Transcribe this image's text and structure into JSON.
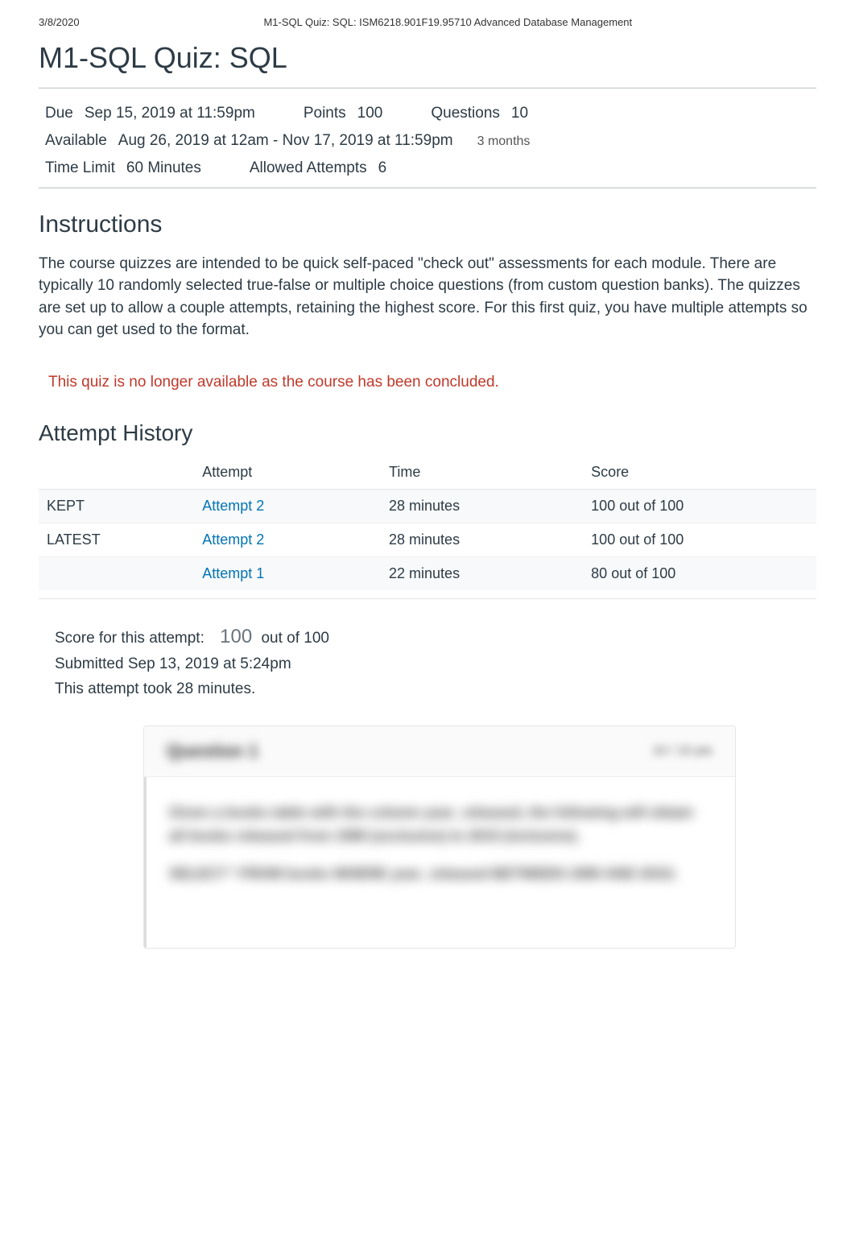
{
  "header": {
    "date": "3/8/2020",
    "course_line": "M1-SQL Quiz: SQL: ISM6218.901F19.95710 Advanced Database Management"
  },
  "title": "M1-SQL Quiz: SQL",
  "meta": {
    "due_label": "Due",
    "due_value": "Sep 15, 2019 at 11:59pm",
    "points_label": "Points",
    "points_value": "100",
    "questions_label": "Questions",
    "questions_value": "10",
    "available_label": "Available",
    "available_value": "Aug 26, 2019 at 12am - Nov 17, 2019 at 11:59pm",
    "available_duration": "3 months",
    "time_limit_label": "Time Limit",
    "time_limit_value": "60 Minutes",
    "allowed_attempts_label": "Allowed Attempts",
    "allowed_attempts_value": "6"
  },
  "instructions": {
    "heading": "Instructions",
    "body": "The course quizzes are intended to be quick self-paced \"check out\" assessments for each module.  There are typically 10 randomly selected true-false or multiple choice questions (from custom question banks).    The quizzes are set up to allow a couple attempts, retaining the highest score.                   For this first quiz, you have multiple attempts so you can get used to the format."
  },
  "alert": "This quiz is no longer available as the course has been concluded.",
  "attempt_history": {
    "heading": "Attempt History",
    "columns": {
      "status": "",
      "attempt": "Attempt",
      "time": "Time",
      "score": "Score"
    },
    "rows": [
      {
        "status": "KEPT",
        "attempt": "Attempt 2",
        "time": "28 minutes",
        "score": "100 out of 100"
      },
      {
        "status": "LATEST",
        "attempt": "Attempt 2",
        "time": "28 minutes",
        "score": "100 out of 100"
      },
      {
        "status": "",
        "attempt": "Attempt 1",
        "time": "22 minutes",
        "score": "80 out of 100"
      }
    ]
  },
  "score_summary": {
    "label": "Score for this attempt:",
    "score": "100",
    "suffix": "out of 100",
    "submitted": "Submitted Sep 13, 2019 at 5:24pm",
    "duration": "This attempt took 28 minutes."
  },
  "question": {
    "title": "Question 1",
    "points": "10 / 10 pts",
    "body_line1": "Given a books table with the column year_released, the following will obtain all books released from 1990 (exclusive) to 2015 (inclusive).",
    "body_line2": "SELECT * FROM books WHERE year_released BETWEEN 1990 AND 2015;"
  }
}
